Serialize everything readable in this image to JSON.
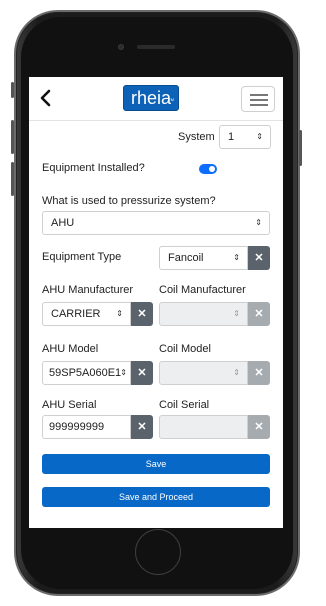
{
  "header": {
    "logo_text": "rheia",
    "logo_mark": "TM",
    "back_icon": "chevron-left-icon",
    "menu_icon": "hamburger-menu-icon"
  },
  "form": {
    "system_label": "System",
    "system_value": "1",
    "equipment_installed_label": "Equipment Installed?",
    "equipment_installed_on": true,
    "pressurize_label": "What is used to pressurize system?",
    "pressurize_value": "AHU",
    "equipment_type_label": "Equipment Type",
    "equipment_type_value": "Fancoil",
    "ahu_manufacturer_label": "AHU Manufacturer",
    "ahu_manufacturer_value": "CARRIER",
    "coil_manufacturer_label": "Coil Manufacturer",
    "coil_manufacturer_value": "",
    "ahu_model_label": "AHU Model",
    "ahu_model_value": "59SP5A060E1",
    "coil_model_label": "Coil Model",
    "coil_model_value": "",
    "ahu_serial_label": "AHU Serial",
    "ahu_serial_value": "999999999",
    "coil_serial_label": "Coil Serial",
    "coil_serial_value": "",
    "clear_symbol": "✕",
    "caret_symbol": "⇕"
  },
  "actions": {
    "save_label": "Save",
    "save_proceed_label": "Save and Proceed"
  },
  "colors": {
    "brand": "#0d62b7",
    "primary_button": "#0868c8",
    "clear_button": "#5a636b",
    "clear_button_disabled": "#a6abb0"
  }
}
